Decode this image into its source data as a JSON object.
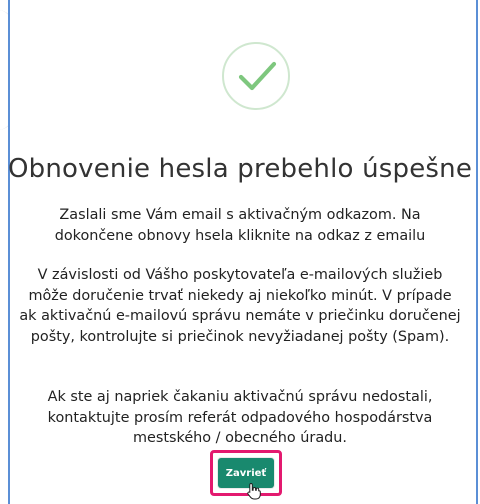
{
  "dialog": {
    "title": "Obnovenie hesla prebehlo úspešne",
    "paragraph1": "Zaslali sme Vám email s aktivačným odkazom. Na dokončene obnovy hsela kliknite na odkaz z emailu",
    "paragraph2": "V závislosti od Vášho poskytovateľa e-mailových služieb môže doručenie trvať niekedy aj niekoľko minút. V prípade ak aktivačnú e-mailovú správu nemáte v priečinku doručenej pošty, kontrolujte si priečinok nevyžiadanej pošty (Spam).",
    "paragraph3": "Ak ste aj napriek čakaniu aktivačnú správu nedostali, kontaktujte prosím referát odpadového hospodárstva mestského / obecného úradu.",
    "close_label": "Zavrieť"
  },
  "icons": {
    "success": "checkmark-icon",
    "pointer": "hand-pointer-icon"
  },
  "colors": {
    "success_green": "#7ec77e",
    "button_green": "#19896e",
    "highlight_pink": "#e3196f",
    "modal_border": "#5b8fd6"
  }
}
